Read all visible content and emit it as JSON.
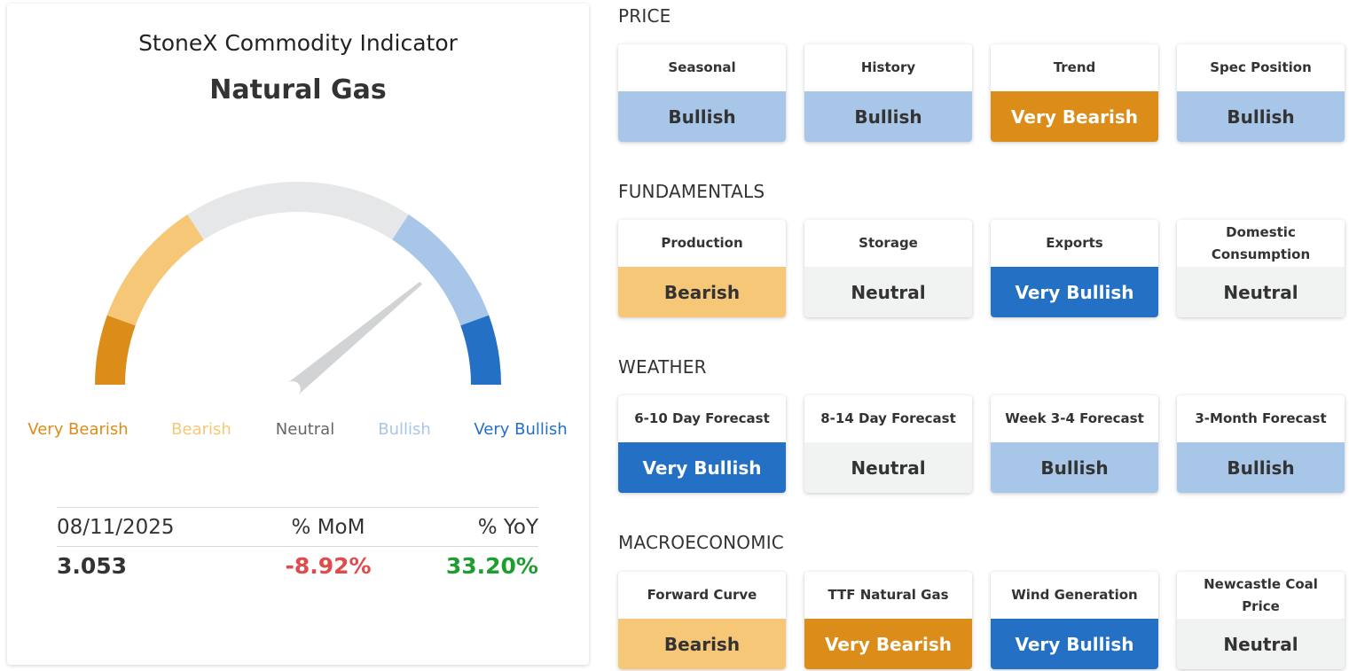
{
  "indicator_title": "StoneX Commodity Indicator",
  "commodity": "Natural Gas",
  "gauge": {
    "value_fraction": 0.78,
    "labels": [
      "Very Bearish",
      "Bearish",
      "Neutral",
      "Bullish",
      "Very Bullish"
    ],
    "colors": {
      "very_bearish": "#DB8C19",
      "bearish": "#F7C778",
      "neutral": "#E6E7E8",
      "bullish": "#A8C6E8",
      "very_bullish": "#2370C5",
      "needle": "#D1D3D4"
    }
  },
  "stats": {
    "headers": [
      "08/11/2025",
      "% MoM",
      "% YoY"
    ],
    "price": "3.053",
    "mom": "-8.92%",
    "yoy": "33.20%",
    "mom_color": "#E04B4B",
    "yoy_color": "#1E9E2E"
  },
  "sections": [
    {
      "title": "PRICE",
      "cards": [
        {
          "label": "Seasonal",
          "value": "Bullish",
          "rating": "bullish"
        },
        {
          "label": "History",
          "value": "Bullish",
          "rating": "bullish"
        },
        {
          "label": "Trend",
          "value": "Very Bearish",
          "rating": "very_bearish"
        },
        {
          "label": "Spec Position",
          "value": "Bullish",
          "rating": "bullish"
        }
      ]
    },
    {
      "title": "FUNDAMENTALS",
      "cards": [
        {
          "label": "Production",
          "value": "Bearish",
          "rating": "bearish"
        },
        {
          "label": "Storage",
          "value": "Neutral",
          "rating": "neutral"
        },
        {
          "label": "Exports",
          "value": "Very Bullish",
          "rating": "very_bullish"
        },
        {
          "label": "Domestic Consumption",
          "value": "Neutral",
          "rating": "neutral"
        }
      ]
    },
    {
      "title": "WEATHER",
      "cards": [
        {
          "label": "6-10 Day Forecast",
          "value": "Very Bullish",
          "rating": "very_bullish"
        },
        {
          "label": "8-14 Day Forecast",
          "value": "Neutral",
          "rating": "neutral"
        },
        {
          "label": "Week 3-4 Forecast",
          "value": "Bullish",
          "rating": "bullish"
        },
        {
          "label": "3-Month Forecast",
          "value": "Bullish",
          "rating": "bullish"
        }
      ]
    },
    {
      "title": "MACROECONOMIC",
      "cards": [
        {
          "label": "Forward Curve",
          "value": "Bearish",
          "rating": "bearish"
        },
        {
          "label": "TTF Natural Gas",
          "value": "Very Bearish",
          "rating": "very_bearish"
        },
        {
          "label": "Wind Generation",
          "value": "Very Bullish",
          "rating": "very_bullish"
        },
        {
          "label": "Newcastle Coal Price",
          "value": "Neutral",
          "rating": "neutral"
        }
      ]
    }
  ],
  "rating_styles": {
    "very_bearish": {
      "bg": "#DB8C19",
      "fg": "#FFFFFF"
    },
    "bearish": {
      "bg": "#F7C778",
      "fg": "#333333"
    },
    "neutral": {
      "bg": "#F1F2F2",
      "fg": "#333333"
    },
    "bullish": {
      "bg": "#A8C6E8",
      "fg": "#333333"
    },
    "very_bullish": {
      "bg": "#2370C5",
      "fg": "#FFFFFF"
    }
  }
}
